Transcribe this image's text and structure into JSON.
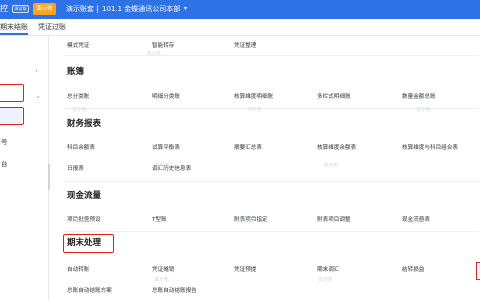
{
  "topbar": {
    "logo_fragment": "控",
    "logo_badge": "测试版",
    "demo_button": "演示账",
    "account_label": "演示账套",
    "company": "101.1 金蝶通讯公司本部",
    "chevron_icon": "chevron-down-icon",
    "accent_color": "#2f72e6",
    "demo_color": "#f7a51d"
  },
  "tabs": [
    {
      "label": "期末结账"
    },
    {
      "label": "凭证过账"
    }
  ],
  "sidebar": {
    "items": [
      {
        "label": "号"
      },
      {
        "label": "台"
      }
    ],
    "highlight_color": "#e02020"
  },
  "main": {
    "top_row": [
      "模式凭证",
      "智能转存",
      "凭证整理"
    ],
    "sections": [
      {
        "title": "账簿",
        "rows": [
          [
            "总分类账",
            "明细分类账",
            "核算维度明细账",
            "多栏式明细账",
            "数量金额总账"
          ]
        ]
      },
      {
        "title": "财务报表",
        "rows": [
          [
            "科目余额表",
            "试算平衡表",
            "摘要汇总表",
            "核算维度余额表",
            "核算维度与科目组合表"
          ],
          [
            "日报表",
            "调汇历史信息表"
          ]
        ]
      },
      {
        "title": "现金流量",
        "rows": [
          [
            "项目批量预设",
            "T型账",
            "附表项目指定",
            "附表项目调整",
            "现金流量表"
          ]
        ]
      },
      {
        "title": "期末处理",
        "rows": [
          [
            "自动转账",
            "凭证摊销",
            "凭证预提",
            "期末调汇",
            "结转损益"
          ],
          [
            "总账自动结账方案",
            "总账自动结账报告"
          ]
        ]
      }
    ],
    "watermark": "演示账"
  }
}
